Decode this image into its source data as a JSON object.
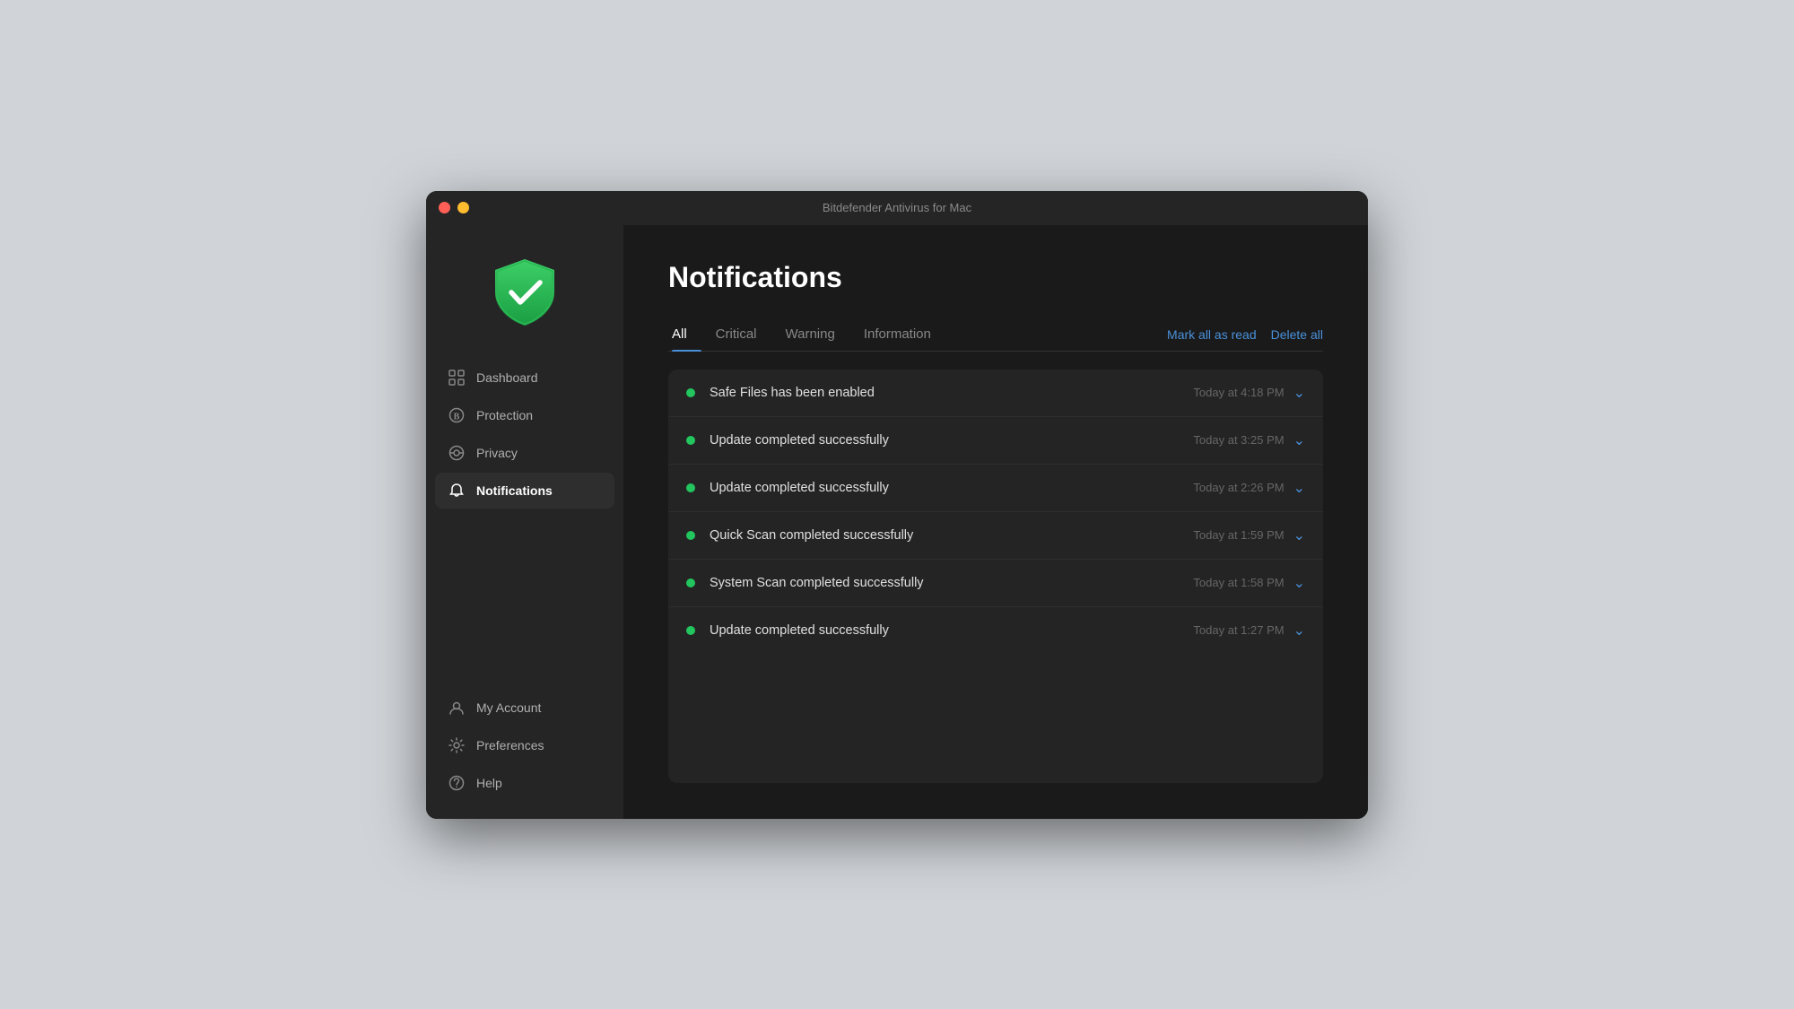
{
  "window": {
    "title": "Bitdefender Antivirus for Mac"
  },
  "sidebar": {
    "logo_alt": "Bitdefender Shield Logo",
    "nav_items": [
      {
        "id": "dashboard",
        "label": "Dashboard",
        "icon": "dashboard-icon",
        "active": false
      },
      {
        "id": "protection",
        "label": "Protection",
        "icon": "protection-icon",
        "active": false
      },
      {
        "id": "privacy",
        "label": "Privacy",
        "icon": "privacy-icon",
        "active": false
      },
      {
        "id": "notifications",
        "label": "Notifications",
        "icon": "bell-icon",
        "active": true
      }
    ],
    "bottom_items": [
      {
        "id": "my-account",
        "label": "My Account",
        "icon": "account-icon",
        "active": false
      },
      {
        "id": "preferences",
        "label": "Preferences",
        "icon": "preferences-icon",
        "active": false
      },
      {
        "id": "help",
        "label": "Help",
        "icon": "help-icon",
        "active": false
      }
    ]
  },
  "content": {
    "page_title": "Notifications",
    "tabs": [
      {
        "id": "all",
        "label": "All",
        "active": true
      },
      {
        "id": "critical",
        "label": "Critical",
        "active": false
      },
      {
        "id": "warning",
        "label": "Warning",
        "active": false
      },
      {
        "id": "information",
        "label": "Information",
        "active": false
      }
    ],
    "actions": {
      "mark_all_read": "Mark all as read",
      "delete_all": "Delete all"
    },
    "notifications": [
      {
        "id": 1,
        "text": "Safe Files has been enabled",
        "time": "Today at 4:18 PM",
        "read": false
      },
      {
        "id": 2,
        "text": "Update completed successfully",
        "time": "Today at 3:25 PM",
        "read": false
      },
      {
        "id": 3,
        "text": "Update completed successfully",
        "time": "Today at 2:26 PM",
        "read": false
      },
      {
        "id": 4,
        "text": "Quick Scan completed successfully",
        "time": "Today at 1:59 PM",
        "read": false
      },
      {
        "id": 5,
        "text": "System Scan completed successfully",
        "time": "Today at 1:58 PM",
        "read": false
      },
      {
        "id": 6,
        "text": "Update completed successfully",
        "time": "Today at 1:27 PM",
        "read": false
      }
    ]
  }
}
